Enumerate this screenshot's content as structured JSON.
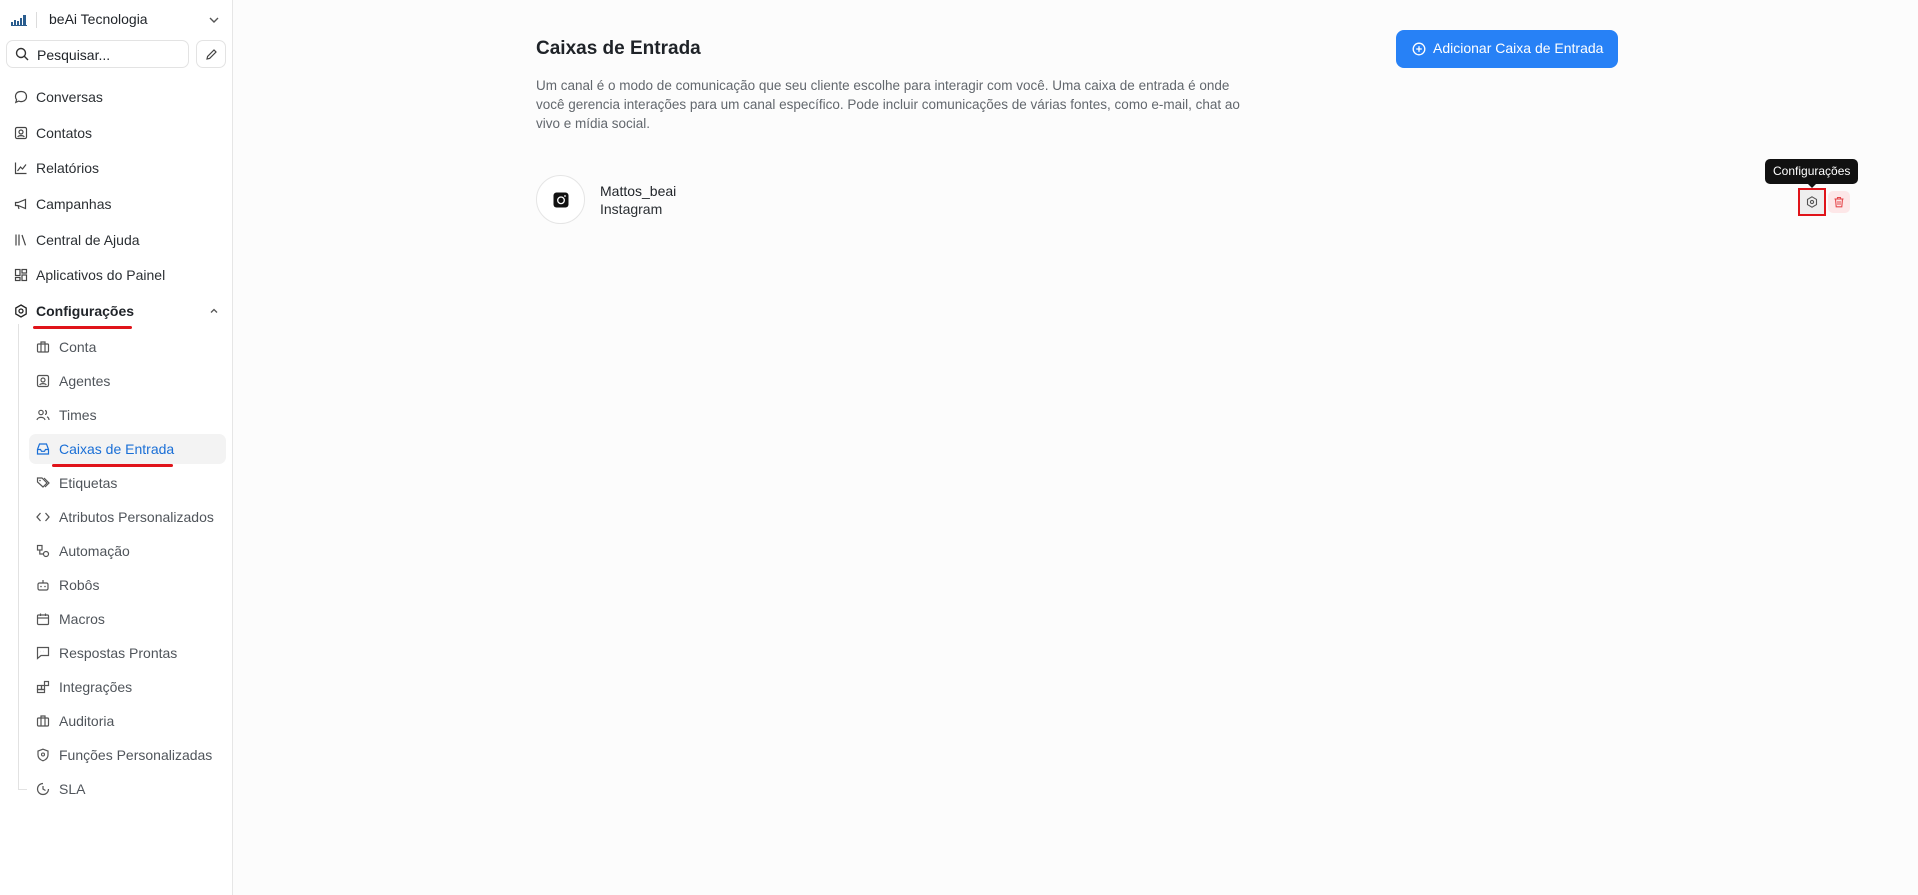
{
  "account": {
    "name": "beAi Tecnologia"
  },
  "search": {
    "placeholder": "Pesquisar..."
  },
  "sidebar": {
    "items": [
      {
        "label": "Conversas",
        "icon": "chat-bubble-icon"
      },
      {
        "label": "Contatos",
        "icon": "contact-card-icon"
      },
      {
        "label": "Relatórios",
        "icon": "line-chart-icon"
      },
      {
        "label": "Campanhas",
        "icon": "megaphone-icon"
      },
      {
        "label": "Central de Ajuda",
        "icon": "library-icon"
      },
      {
        "label": "Aplicativos do Painel",
        "icon": "dashboard-grid-icon"
      },
      {
        "label": "Configurações",
        "icon": "settings-icon",
        "expanded": true
      }
    ],
    "settings_children": [
      {
        "label": "Conta",
        "icon": "briefcase-icon"
      },
      {
        "label": "Agentes",
        "icon": "agent-icon"
      },
      {
        "label": "Times",
        "icon": "users-icon"
      },
      {
        "label": "Caixas de Entrada",
        "icon": "inbox-icon",
        "active": true
      },
      {
        "label": "Etiquetas",
        "icon": "tags-icon"
      },
      {
        "label": "Atributos Personalizados",
        "icon": "code-icon"
      },
      {
        "label": "Automação",
        "icon": "automation-icon"
      },
      {
        "label": "Robôs",
        "icon": "bot-icon"
      },
      {
        "label": "Macros",
        "icon": "calendar-icon"
      },
      {
        "label": "Respostas Prontas",
        "icon": "message-square-icon"
      },
      {
        "label": "Integrações",
        "icon": "blocks-icon"
      },
      {
        "label": "Auditoria",
        "icon": "briefcase-icon"
      },
      {
        "label": "Funções Personalizadas",
        "icon": "shield-icon"
      },
      {
        "label": "SLA",
        "icon": "clock-icon"
      }
    ]
  },
  "main": {
    "title": "Caixas de Entrada",
    "description": "Um canal é o modo de comunicação que seu cliente escolhe para interagir com você. Uma caixa de entrada é onde você gerencia interações para um canal específico. Pode incluir comunicações de várias fontes, como e-mail, chat ao vivo e mídia social.",
    "add_button": "Adicionar Caixa de Entrada",
    "inboxes": [
      {
        "name": "Mattos_beai",
        "channel": "Instagram",
        "icon": "instagram-icon"
      }
    ],
    "tooltip": "Configurações"
  },
  "colors": {
    "accent": "#2781f6",
    "active_text": "#1a6fd6",
    "annotation_red": "#e0141a",
    "danger": "#e5484d"
  }
}
